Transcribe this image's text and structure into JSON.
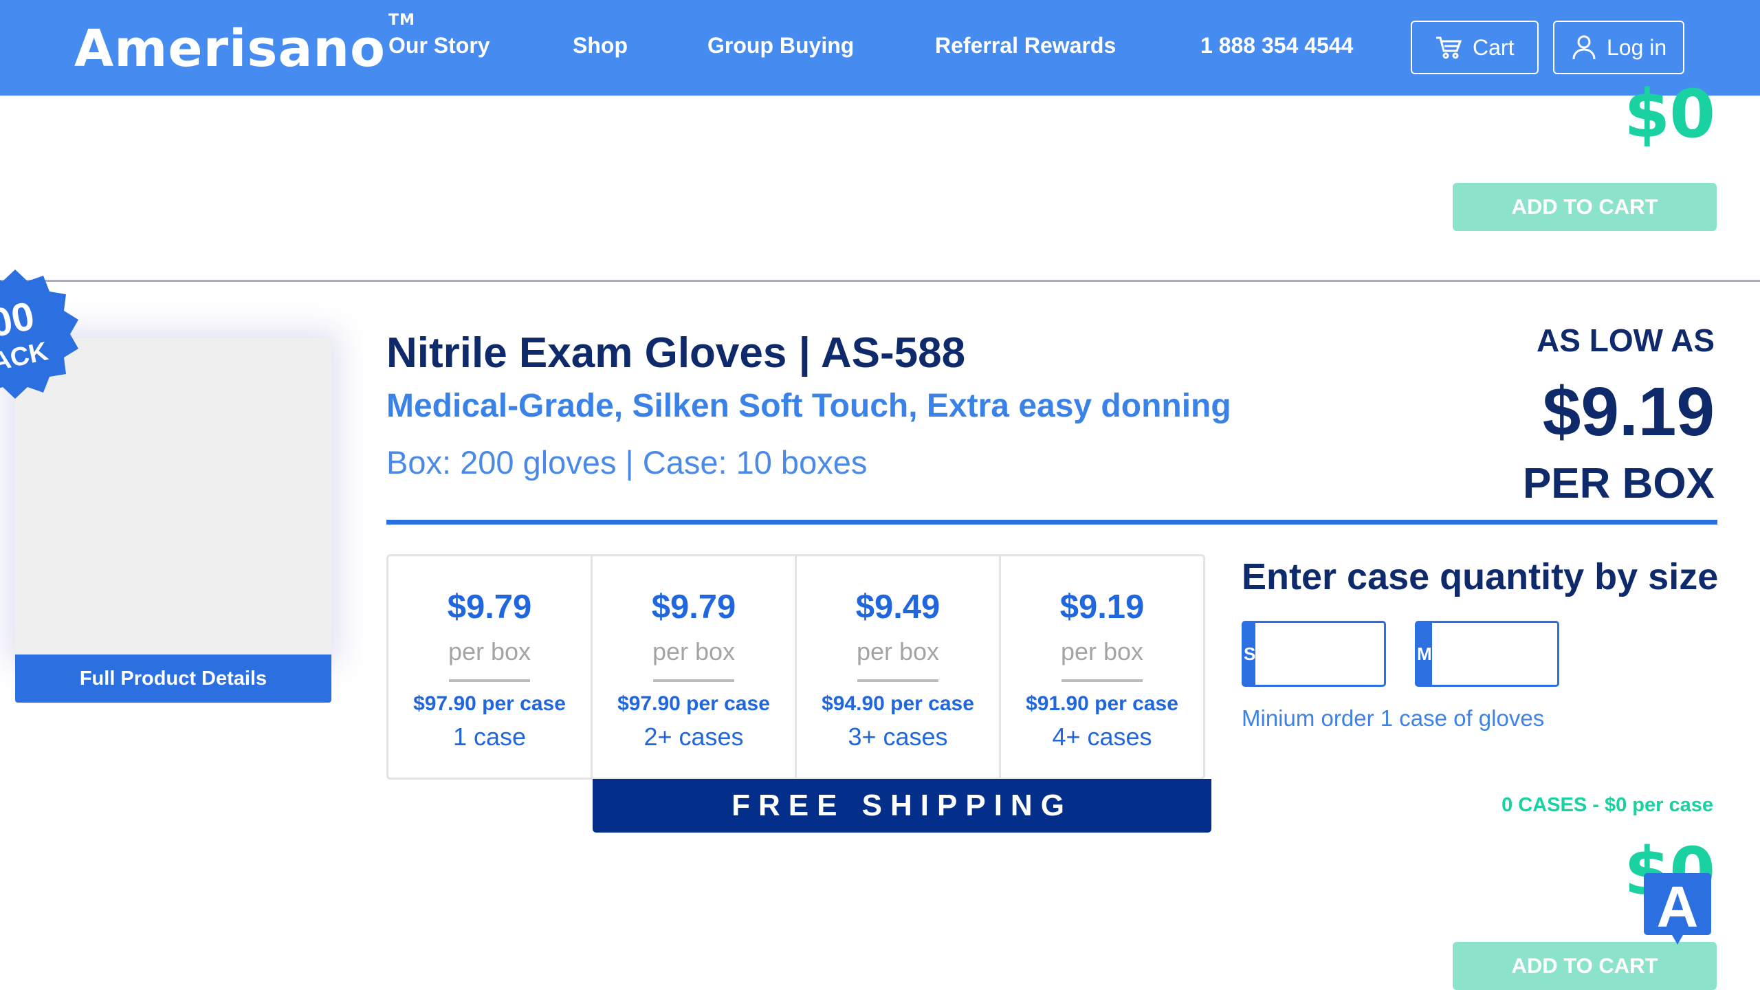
{
  "header": {
    "logo": "Amerisano",
    "logo_tm": "TM",
    "nav": [
      "Our Story",
      "Shop",
      "Group Buying",
      "Referral Rewards",
      "1 888 354 4544"
    ],
    "cart_label": "Cart",
    "login_label": "Log in"
  },
  "top_row": {
    "total": "$0",
    "add_to_cart": "ADD TO CART"
  },
  "product": {
    "badge_line1": "00",
    "badge_line2": "ACK",
    "details_button": "Full Product Details",
    "title": "Nitrile Exam Gloves | AS-588",
    "subtitle": "Medical-Grade, Silken Soft Touch, Extra easy donning",
    "pack_info": "Box: 200 gloves | Case: 10 boxes",
    "as_low_as": "AS LOW AS",
    "low_price": "$9.19",
    "per_box": "PER BOX",
    "tiers": [
      {
        "price": "$9.79",
        "unit": "per box",
        "case_price": "$97.90 per case",
        "qty": "1 case"
      },
      {
        "price": "$9.79",
        "unit": "per box",
        "case_price": "$97.90 per case",
        "qty": "2+ cases"
      },
      {
        "price": "$9.49",
        "unit": "per box",
        "case_price": "$94.90 per case",
        "qty": "3+ cases"
      },
      {
        "price": "$9.19",
        "unit": "per box",
        "case_price": "$91.90 per case",
        "qty": "4+ cases"
      }
    ],
    "free_shipping": "FREE SHIPPING",
    "qty_title": "Enter case quantity by size",
    "sizes": [
      {
        "label": "S",
        "value": ""
      },
      {
        "label": "M",
        "value": ""
      }
    ],
    "min_order": "Minium order 1 case of gloves",
    "cases_summary": "0 CASES - $0 per case",
    "total": "$0",
    "add_to_cart": "ADD TO CART",
    "chat_letter": "A"
  },
  "colors": {
    "header_bg": "#468bef",
    "navy": "#0f2a6b",
    "accent_blue": "#2b6fe0",
    "green": "#19d1a1",
    "cart_btn_disabled": "#8de2cc",
    "free_ship_bg": "#032f8b"
  }
}
